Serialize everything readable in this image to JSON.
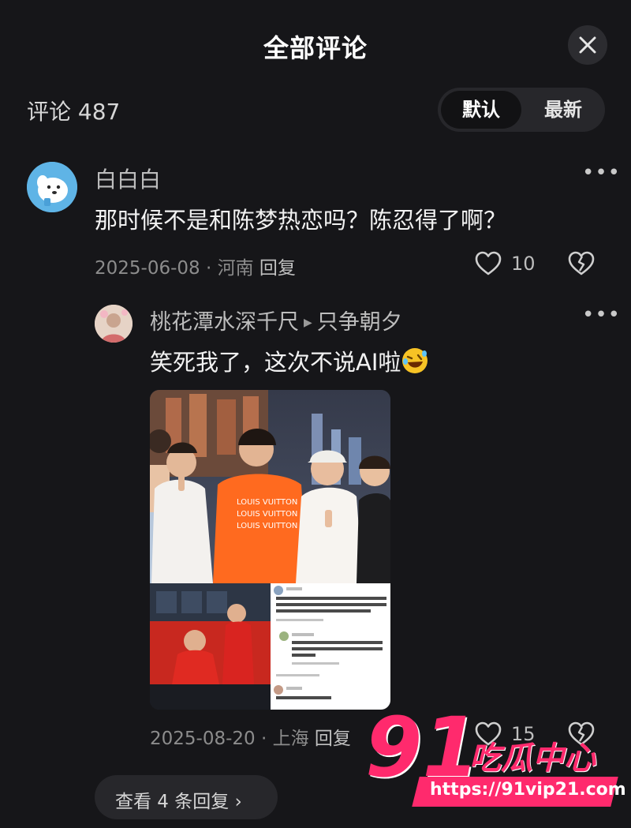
{
  "header": {
    "title": "全部评论",
    "close_icon": "close-icon"
  },
  "comments_bar": {
    "count_label": "评论 487",
    "sort": {
      "default_label": "默认",
      "latest_label": "最新",
      "selected": "默认"
    }
  },
  "comment": {
    "username": "白白白",
    "text": "那时候不是和陈梦热恋吗？陈忍得了啊？",
    "meta": "2025-06-08 · 河南",
    "reply_label": "回复",
    "likes": "10"
  },
  "reply": {
    "username": "桃花潭水深千尺",
    "reply_to": "只争朝夕",
    "text": "笑死我了，这次不说AI啦",
    "emoji_icon": "rolling-laugh-emoji-icon",
    "meta": "2025-08-20 · 上海",
    "reply_label": "回复",
    "likes": "15"
  },
  "view_replies_label": "查看 4 条回复 ›",
  "watermark": {
    "number": "91",
    "word": "吃瓜中心",
    "url": "https://91vip21.com"
  },
  "colors": {
    "background": "#161619",
    "watermark_pink": "#ff2a6d"
  }
}
